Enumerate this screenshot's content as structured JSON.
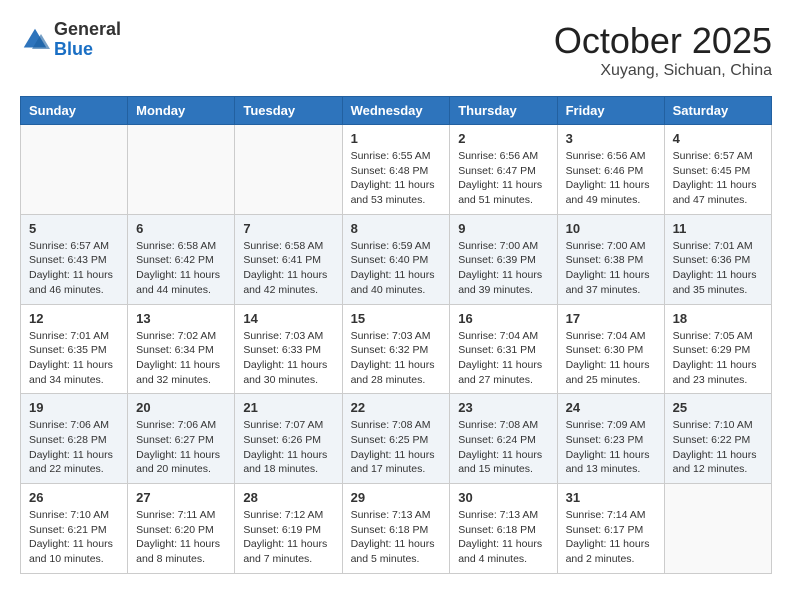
{
  "header": {
    "logo_general": "General",
    "logo_blue": "Blue",
    "month_title": "October 2025",
    "location": "Xuyang, Sichuan, China"
  },
  "days_of_week": [
    "Sunday",
    "Monday",
    "Tuesday",
    "Wednesday",
    "Thursday",
    "Friday",
    "Saturday"
  ],
  "weeks": [
    [
      {
        "day": "",
        "info": ""
      },
      {
        "day": "",
        "info": ""
      },
      {
        "day": "",
        "info": ""
      },
      {
        "day": "1",
        "info": "Sunrise: 6:55 AM\nSunset: 6:48 PM\nDaylight: 11 hours\nand 53 minutes."
      },
      {
        "day": "2",
        "info": "Sunrise: 6:56 AM\nSunset: 6:47 PM\nDaylight: 11 hours\nand 51 minutes."
      },
      {
        "day": "3",
        "info": "Sunrise: 6:56 AM\nSunset: 6:46 PM\nDaylight: 11 hours\nand 49 minutes."
      },
      {
        "day": "4",
        "info": "Sunrise: 6:57 AM\nSunset: 6:45 PM\nDaylight: 11 hours\nand 47 minutes."
      }
    ],
    [
      {
        "day": "5",
        "info": "Sunrise: 6:57 AM\nSunset: 6:43 PM\nDaylight: 11 hours\nand 46 minutes."
      },
      {
        "day": "6",
        "info": "Sunrise: 6:58 AM\nSunset: 6:42 PM\nDaylight: 11 hours\nand 44 minutes."
      },
      {
        "day": "7",
        "info": "Sunrise: 6:58 AM\nSunset: 6:41 PM\nDaylight: 11 hours\nand 42 minutes."
      },
      {
        "day": "8",
        "info": "Sunrise: 6:59 AM\nSunset: 6:40 PM\nDaylight: 11 hours\nand 40 minutes."
      },
      {
        "day": "9",
        "info": "Sunrise: 7:00 AM\nSunset: 6:39 PM\nDaylight: 11 hours\nand 39 minutes."
      },
      {
        "day": "10",
        "info": "Sunrise: 7:00 AM\nSunset: 6:38 PM\nDaylight: 11 hours\nand 37 minutes."
      },
      {
        "day": "11",
        "info": "Sunrise: 7:01 AM\nSunset: 6:36 PM\nDaylight: 11 hours\nand 35 minutes."
      }
    ],
    [
      {
        "day": "12",
        "info": "Sunrise: 7:01 AM\nSunset: 6:35 PM\nDaylight: 11 hours\nand 34 minutes."
      },
      {
        "day": "13",
        "info": "Sunrise: 7:02 AM\nSunset: 6:34 PM\nDaylight: 11 hours\nand 32 minutes."
      },
      {
        "day": "14",
        "info": "Sunrise: 7:03 AM\nSunset: 6:33 PM\nDaylight: 11 hours\nand 30 minutes."
      },
      {
        "day": "15",
        "info": "Sunrise: 7:03 AM\nSunset: 6:32 PM\nDaylight: 11 hours\nand 28 minutes."
      },
      {
        "day": "16",
        "info": "Sunrise: 7:04 AM\nSunset: 6:31 PM\nDaylight: 11 hours\nand 27 minutes."
      },
      {
        "day": "17",
        "info": "Sunrise: 7:04 AM\nSunset: 6:30 PM\nDaylight: 11 hours\nand 25 minutes."
      },
      {
        "day": "18",
        "info": "Sunrise: 7:05 AM\nSunset: 6:29 PM\nDaylight: 11 hours\nand 23 minutes."
      }
    ],
    [
      {
        "day": "19",
        "info": "Sunrise: 7:06 AM\nSunset: 6:28 PM\nDaylight: 11 hours\nand 22 minutes."
      },
      {
        "day": "20",
        "info": "Sunrise: 7:06 AM\nSunset: 6:27 PM\nDaylight: 11 hours\nand 20 minutes."
      },
      {
        "day": "21",
        "info": "Sunrise: 7:07 AM\nSunset: 6:26 PM\nDaylight: 11 hours\nand 18 minutes."
      },
      {
        "day": "22",
        "info": "Sunrise: 7:08 AM\nSunset: 6:25 PM\nDaylight: 11 hours\nand 17 minutes."
      },
      {
        "day": "23",
        "info": "Sunrise: 7:08 AM\nSunset: 6:24 PM\nDaylight: 11 hours\nand 15 minutes."
      },
      {
        "day": "24",
        "info": "Sunrise: 7:09 AM\nSunset: 6:23 PM\nDaylight: 11 hours\nand 13 minutes."
      },
      {
        "day": "25",
        "info": "Sunrise: 7:10 AM\nSunset: 6:22 PM\nDaylight: 11 hours\nand 12 minutes."
      }
    ],
    [
      {
        "day": "26",
        "info": "Sunrise: 7:10 AM\nSunset: 6:21 PM\nDaylight: 11 hours\nand 10 minutes."
      },
      {
        "day": "27",
        "info": "Sunrise: 7:11 AM\nSunset: 6:20 PM\nDaylight: 11 hours\nand 8 minutes."
      },
      {
        "day": "28",
        "info": "Sunrise: 7:12 AM\nSunset: 6:19 PM\nDaylight: 11 hours\nand 7 minutes."
      },
      {
        "day": "29",
        "info": "Sunrise: 7:13 AM\nSunset: 6:18 PM\nDaylight: 11 hours\nand 5 minutes."
      },
      {
        "day": "30",
        "info": "Sunrise: 7:13 AM\nSunset: 6:18 PM\nDaylight: 11 hours\nand 4 minutes."
      },
      {
        "day": "31",
        "info": "Sunrise: 7:14 AM\nSunset: 6:17 PM\nDaylight: 11 hours\nand 2 minutes."
      },
      {
        "day": "",
        "info": ""
      }
    ]
  ]
}
